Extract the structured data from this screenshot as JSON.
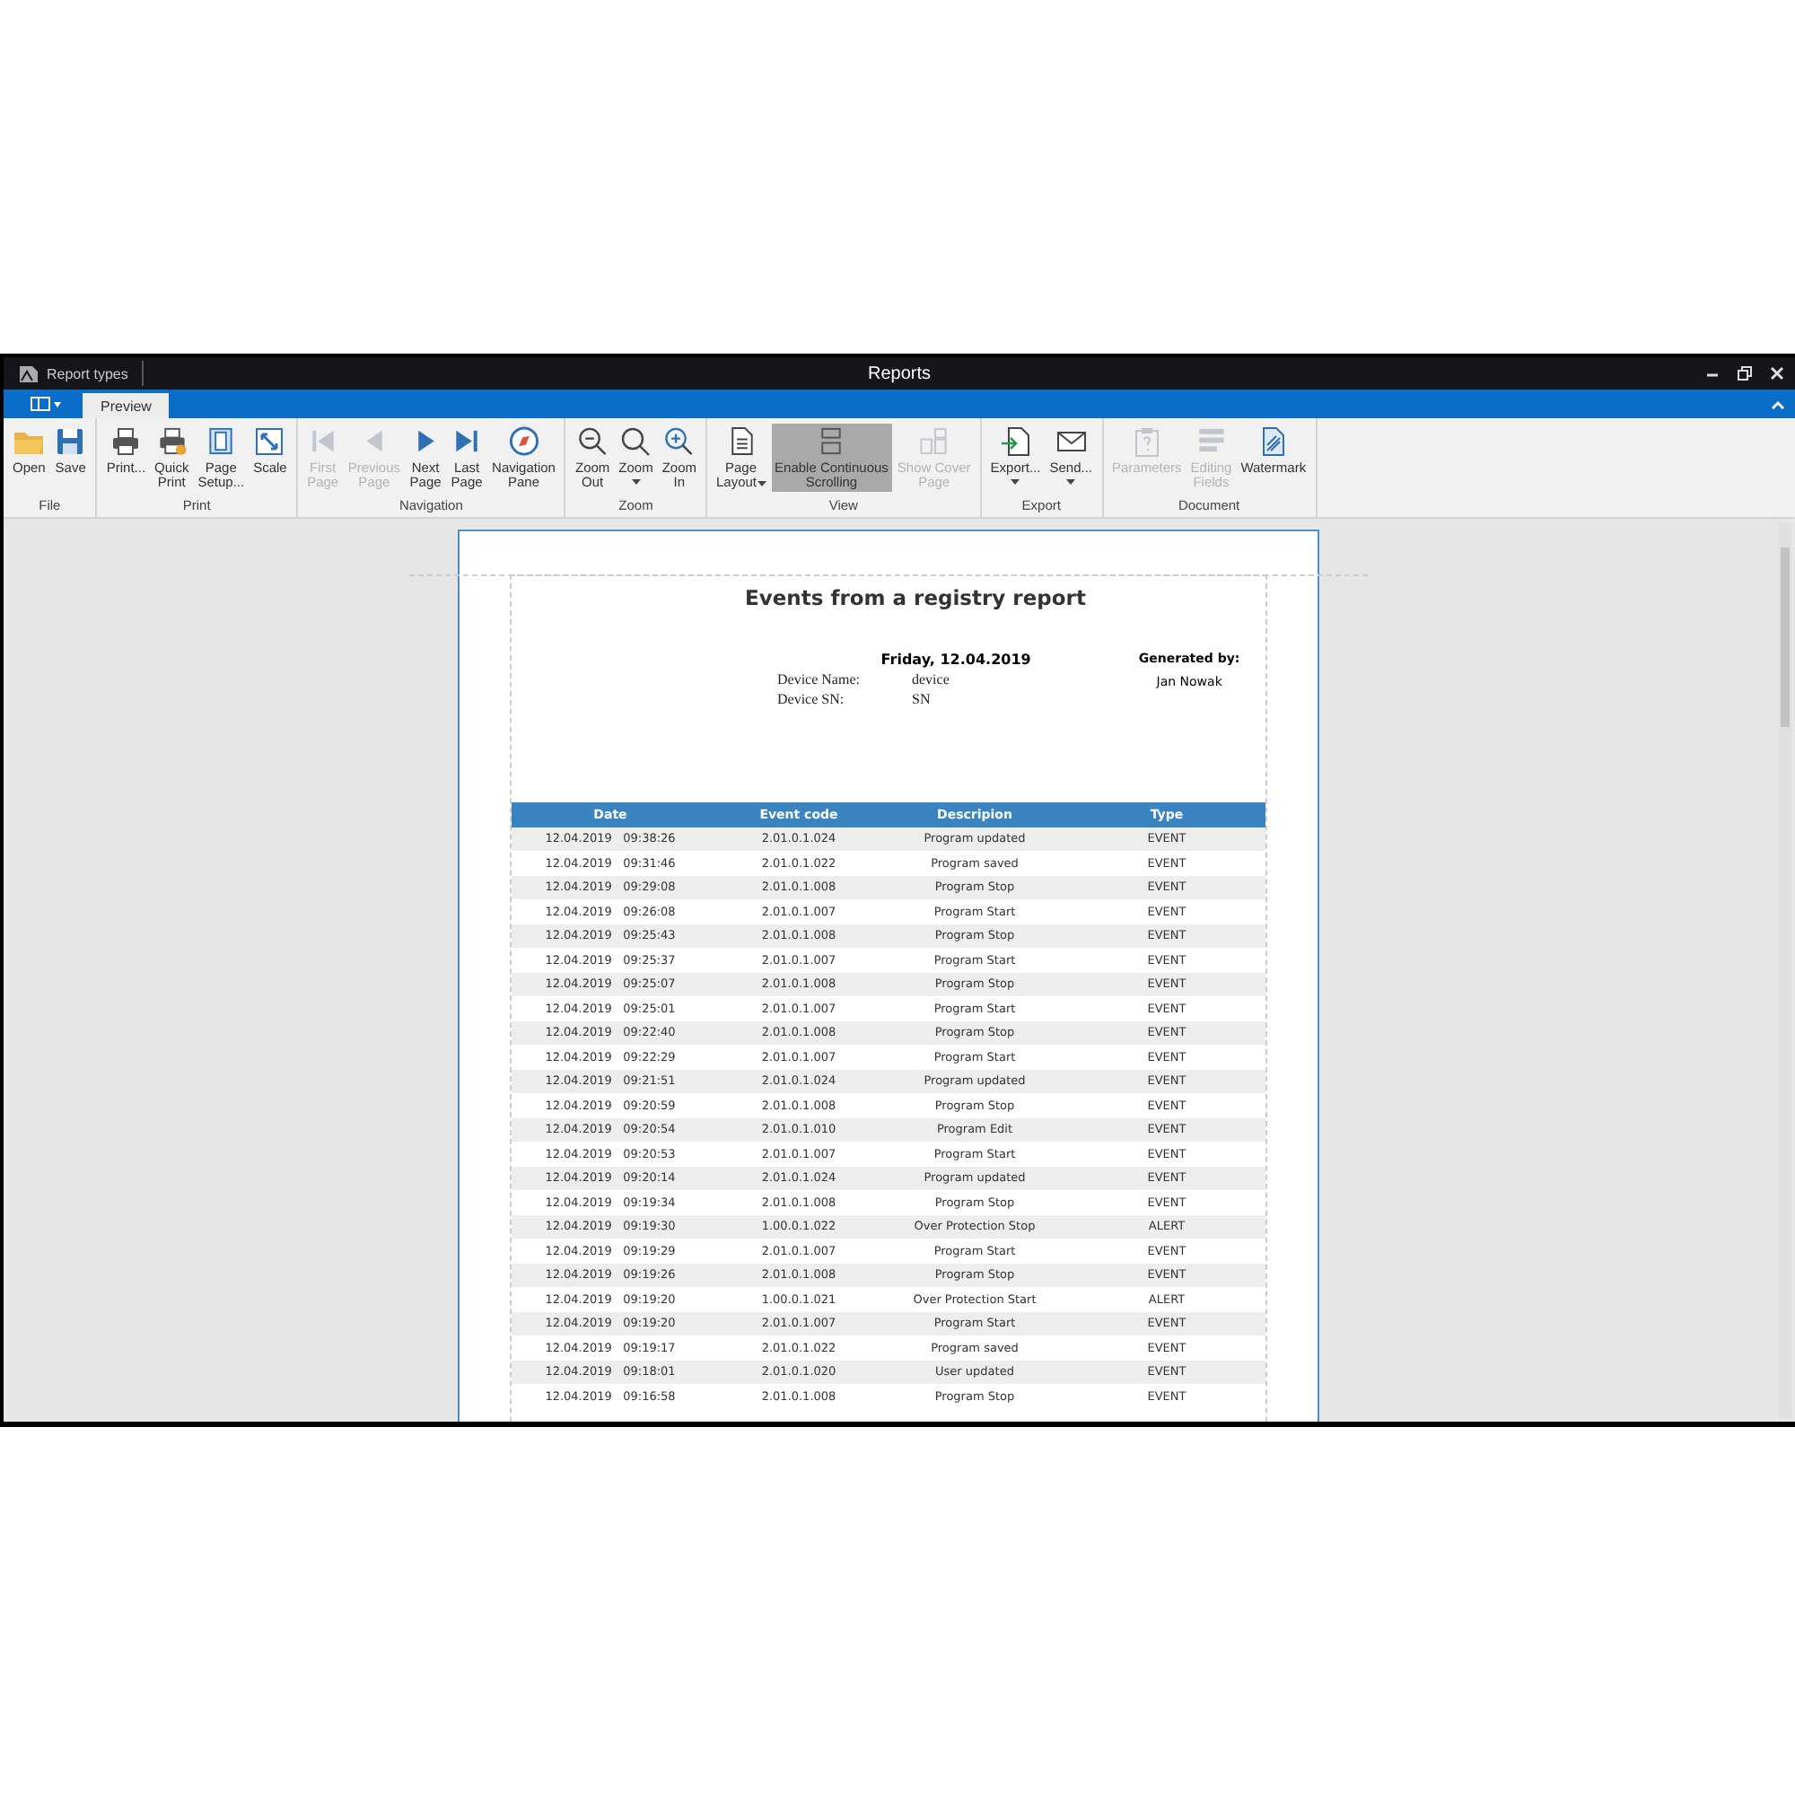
{
  "window": {
    "title": "Reports",
    "document_tab": "Report types"
  },
  "ribbon": {
    "tabs": [
      {
        "label": "Preview",
        "selected": true
      }
    ],
    "groups": [
      {
        "label": "File",
        "buttons": [
          {
            "label": "Open",
            "disabled": false,
            "selected": false,
            "dropdown": false
          },
          {
            "label": "Save",
            "disabled": false,
            "selected": false,
            "dropdown": false
          }
        ]
      },
      {
        "label": "Print",
        "buttons": [
          {
            "label": "Print...",
            "disabled": false,
            "selected": false,
            "dropdown": false
          },
          {
            "label": "Quick\nPrint",
            "disabled": false,
            "selected": false,
            "dropdown": false
          },
          {
            "label": "Page\nSetup...",
            "disabled": false,
            "selected": false,
            "dropdown": false
          },
          {
            "label": "Scale",
            "disabled": false,
            "selected": false,
            "dropdown": false
          }
        ]
      },
      {
        "label": "Navigation",
        "buttons": [
          {
            "label": "First\nPage",
            "disabled": true,
            "selected": false,
            "dropdown": false
          },
          {
            "label": "Previous\nPage",
            "disabled": true,
            "selected": false,
            "dropdown": false
          },
          {
            "label": "Next\nPage",
            "disabled": false,
            "selected": false,
            "dropdown": false
          },
          {
            "label": "Last\nPage",
            "disabled": false,
            "selected": false,
            "dropdown": false
          },
          {
            "label": "Navigation\nPane",
            "disabled": false,
            "selected": false,
            "dropdown": false
          }
        ]
      },
      {
        "label": "Zoom",
        "buttons": [
          {
            "label": "Zoom\nOut",
            "disabled": false,
            "selected": false,
            "dropdown": false
          },
          {
            "label": "Zoom",
            "disabled": false,
            "selected": false,
            "dropdown": true
          },
          {
            "label": "Zoom\nIn",
            "disabled": false,
            "selected": false,
            "dropdown": false
          }
        ]
      },
      {
        "label": "View",
        "buttons": [
          {
            "label": "Page\nLayout",
            "disabled": false,
            "selected": false,
            "dropdown": true
          },
          {
            "label": "Enable Continuous\nScrolling",
            "disabled": false,
            "selected": true,
            "dropdown": false
          },
          {
            "label": "Show Cover\nPage",
            "disabled": true,
            "selected": false,
            "dropdown": false
          }
        ]
      },
      {
        "label": "Export",
        "buttons": [
          {
            "label": "Export...",
            "disabled": false,
            "selected": false,
            "dropdown": true
          },
          {
            "label": "Send...",
            "disabled": false,
            "selected": false,
            "dropdown": true
          }
        ]
      },
      {
        "label": "Document",
        "buttons": [
          {
            "label": "Parameters",
            "disabled": true,
            "selected": false,
            "dropdown": false
          },
          {
            "label": "Editing\nFields",
            "disabled": true,
            "selected": false,
            "dropdown": false
          },
          {
            "label": "Watermark",
            "disabled": false,
            "selected": false,
            "dropdown": false
          }
        ]
      }
    ]
  },
  "report": {
    "title": "Events from a registry report",
    "date": "Friday, 12.04.2019",
    "fields": [
      {
        "label": "Device Name:",
        "value": "device"
      },
      {
        "label": "Device SN:",
        "value": "SN"
      }
    ],
    "generated_by_label": "Generated by:",
    "generated_by": "Jan Nowak",
    "columns": [
      "Date",
      "Event code",
      "Descripion",
      "Type"
    ],
    "rows": [
      [
        "12.04.2019   09:38:26",
        "2.01.0.1.024",
        "Program updated",
        "EVENT"
      ],
      [
        "12.04.2019   09:31:46",
        "2.01.0.1.022",
        "Program saved",
        "EVENT"
      ],
      [
        "12.04.2019   09:29:08",
        "2.01.0.1.008",
        "Program Stop",
        "EVENT"
      ],
      [
        "12.04.2019   09:26:08",
        "2.01.0.1.007",
        "Program Start",
        "EVENT"
      ],
      [
        "12.04.2019   09:25:43",
        "2.01.0.1.008",
        "Program Stop",
        "EVENT"
      ],
      [
        "12.04.2019   09:25:37",
        "2.01.0.1.007",
        "Program Start",
        "EVENT"
      ],
      [
        "12.04.2019   09:25:07",
        "2.01.0.1.008",
        "Program Stop",
        "EVENT"
      ],
      [
        "12.04.2019   09:25:01",
        "2.01.0.1.007",
        "Program Start",
        "EVENT"
      ],
      [
        "12.04.2019   09:22:40",
        "2.01.0.1.008",
        "Program Stop",
        "EVENT"
      ],
      [
        "12.04.2019   09:22:29",
        "2.01.0.1.007",
        "Program Start",
        "EVENT"
      ],
      [
        "12.04.2019   09:21:51",
        "2.01.0.1.024",
        "Program updated",
        "EVENT"
      ],
      [
        "12.04.2019   09:20:59",
        "2.01.0.1.008",
        "Program Stop",
        "EVENT"
      ],
      [
        "12.04.2019   09:20:54",
        "2.01.0.1.010",
        "Program Edit",
        "EVENT"
      ],
      [
        "12.04.2019   09:20:53",
        "2.01.0.1.007",
        "Program Start",
        "EVENT"
      ],
      [
        "12.04.2019   09:20:14",
        "2.01.0.1.024",
        "Program updated",
        "EVENT"
      ],
      [
        "12.04.2019   09:19:34",
        "2.01.0.1.008",
        "Program Stop",
        "EVENT"
      ],
      [
        "12.04.2019   09:19:30",
        "1.00.0.1.022",
        "Over Protection Stop",
        "ALERT"
      ],
      [
        "12.04.2019   09:19:29",
        "2.01.0.1.007",
        "Program Start",
        "EVENT"
      ],
      [
        "12.04.2019   09:19:26",
        "2.01.0.1.008",
        "Program Stop",
        "EVENT"
      ],
      [
        "12.04.2019   09:19:20",
        "1.00.0.1.021",
        "Over Protection Start",
        "ALERT"
      ],
      [
        "12.04.2019   09:19:20",
        "2.01.0.1.007",
        "Program Start",
        "EVENT"
      ],
      [
        "12.04.2019   09:19:17",
        "2.01.0.1.022",
        "Program saved",
        "EVENT"
      ],
      [
        "12.04.2019   09:18:01",
        "2.01.0.1.020",
        "User updated",
        "EVENT"
      ],
      [
        "12.04.2019   09:16:58",
        "2.01.0.1.008",
        "Program Stop",
        "EVENT"
      ]
    ]
  }
}
